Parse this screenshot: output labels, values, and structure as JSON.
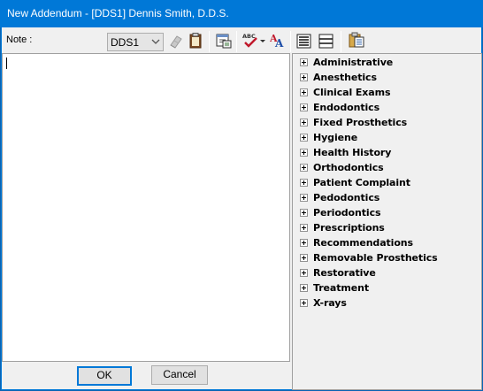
{
  "window": {
    "title": "New Addendum - [DDS1] Dennis Smith, D.D.S."
  },
  "toolbar": {
    "note_label": "Note :",
    "provider_value": "DDS1",
    "icons": [
      "chevron-down-icon",
      "eraser-icon",
      "clipboard-icon",
      "spell-check-icon",
      "font-icon",
      "list-lines-icon",
      "list-bordered-icon",
      "paste-template-icon"
    ]
  },
  "buttons": {
    "ok_label": "OK",
    "cancel_label": "Cancel"
  },
  "tree": {
    "items": [
      {
        "label": "Administrative"
      },
      {
        "label": "Anesthetics"
      },
      {
        "label": "Clinical Exams"
      },
      {
        "label": "Endodontics"
      },
      {
        "label": "Fixed Prosthetics"
      },
      {
        "label": "Hygiene"
      },
      {
        "label": "Health History"
      },
      {
        "label": "Orthodontics"
      },
      {
        "label": "Patient Complaint"
      },
      {
        "label": "Pedodontics"
      },
      {
        "label": "Periodontics"
      },
      {
        "label": "Prescriptions"
      },
      {
        "label": "Recommendations"
      },
      {
        "label": "Removable Prosthetics"
      },
      {
        "label": "Restorative"
      },
      {
        "label": "Treatment"
      },
      {
        "label": "X-rays"
      }
    ]
  },
  "colors": {
    "titlebar": "#0078d7",
    "window_bg": "#f0f0f0",
    "default_button_border": "#0078d7"
  }
}
